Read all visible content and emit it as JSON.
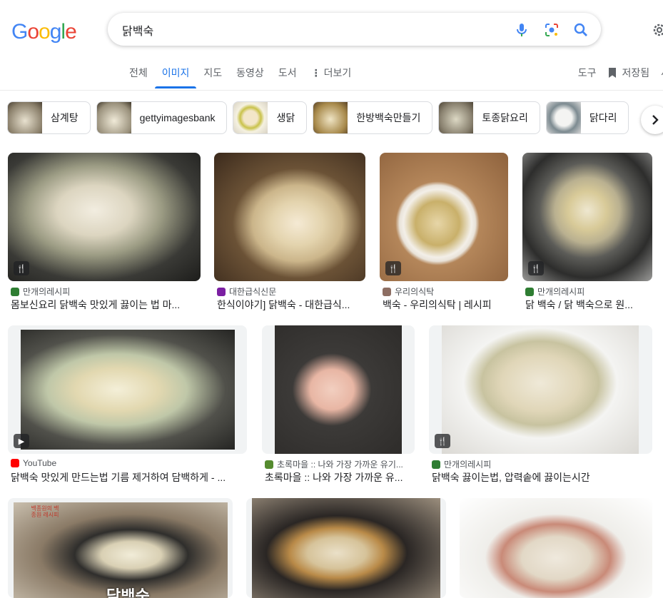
{
  "logo": "Google",
  "search": {
    "query": "닭백숙"
  },
  "tabs": [
    "전체",
    "이미지",
    "지도",
    "동영상",
    "도서",
    "더보기"
  ],
  "right_nav": {
    "tools": "도구",
    "saved": "저장됨"
  },
  "chips": [
    "삼계탕",
    "gettyimagesbank",
    "생닭",
    "한방백숙만들기",
    "토종닭요리",
    "닭다리"
  ],
  "results": [
    {
      "source": "만개의레시피",
      "title": "몸보신요리 닭백숙 맛있게 끓이는 법 마...",
      "fav_color": "#2e7d32"
    },
    {
      "source": "대한급식신문",
      "title": "한식이야기] 닭백숙 - 대한급식...",
      "fav_color": "#7b1fa2"
    },
    {
      "source": "우리의식탁",
      "title": "백숙 - 우리의식탁 | 레시피",
      "fav_color": "#8d6e63"
    },
    {
      "source": "만개의레시피",
      "title": "닭 백숙 / 닭 백숙으로 원...",
      "fav_color": "#2e7d32"
    },
    {
      "source": "YouTube",
      "title": "닭백숙 맛있게 만드는법 기름 제거하여 담백하게 - ...",
      "fav_color": "#ff0000"
    },
    {
      "source": "초록마을 :: 나와 가장 가까운 유기...",
      "title": "초록마을 :: 나와 가장 가까운 유...",
      "fav_color": "#558b2f"
    },
    {
      "source": "만개의레시피",
      "title": "닭백숙 끓이는법, 압력솥에 끓이는시간",
      "fav_color": "#2e7d32"
    }
  ],
  "thumb_text": {
    "r7_caption": "닭백숙",
    "r7_label": "백종원의 백종원 레시피"
  }
}
